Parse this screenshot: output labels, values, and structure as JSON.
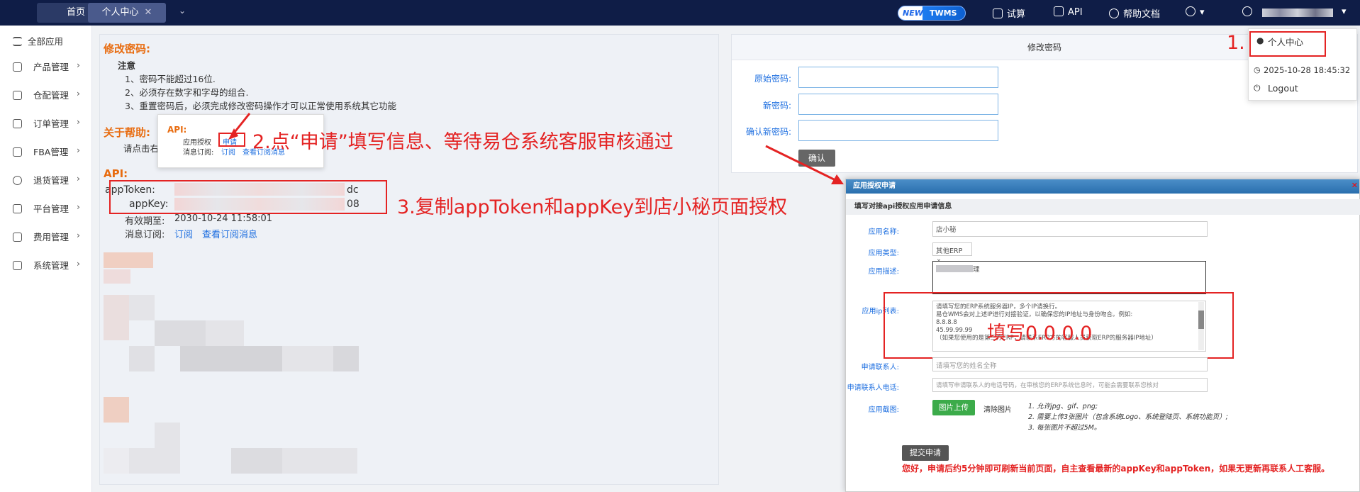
{
  "topbar": {
    "tabs": [
      "首页",
      "个人中心"
    ],
    "tab_close": "✕",
    "tab_more": "⌄",
    "new_badge_new": "NEW",
    "new_badge_brand": "TWMS",
    "nav": [
      "试算",
      "API",
      "帮助文档"
    ]
  },
  "sidebar": {
    "all_apps": "全部应用",
    "items": [
      "产品管理",
      "仓配管理",
      "订单管理",
      "FBA管理",
      "退货管理",
      "平台管理",
      "费用管理",
      "系统管理"
    ]
  },
  "main": {
    "change_pw_title": "修改密码:",
    "notice_title": "注意",
    "notices": [
      "1、密码不能超过16位.",
      "2、必须存在数字和字母的组合.",
      "3、重置密码后，必须完成修改密码操作才可以正常使用系统其它功能"
    ],
    "help_title": "关于帮助:",
    "help_text": "请点击右",
    "api_title": "API:",
    "app_token_label": "appToken:",
    "app_token_tail": "dc",
    "app_key_label": "appKey:",
    "app_key_tail": "08",
    "expire_label": "有效期至:",
    "expire_value": "2030-10-24 11:58:01",
    "subscribe_label": "消息订阅:",
    "subscribe_link": "订阅",
    "view_subscribe_link": "查看订阅消息"
  },
  "api_popup": {
    "title": "API:",
    "auth_label": "应用授权",
    "apply_link": "申请",
    "sub_label": "消息订阅:",
    "sub_link": "订阅",
    "view_link": "查看订阅消息"
  },
  "annotations": {
    "a1": "1.",
    "a2": "2.点“申请”填写信息、等待易仓系统客服审核通过",
    "a3": "3.复制appToken和appKey到店小秘页面授权",
    "a4": "填写0.0.0.0"
  },
  "pw_panel": {
    "title": "修改密码",
    "old_label": "原始密码:",
    "new_label": "新密码:",
    "confirm_label": "确认新密码:",
    "confirm_button": "确认"
  },
  "user_menu": {
    "personal_center": "个人中心",
    "timestamp": "2025-10-28 18:45:32",
    "logout": "Logout"
  },
  "dialog": {
    "title": "应用授权申请",
    "close": "✕",
    "subtitle": "填写对接api授权应用申请信息",
    "app_name_label": "应用名称:",
    "app_name_value": "店小秘",
    "app_type_label": "应用类型:",
    "app_type_value": "其他ERP",
    "app_desc_label": "应用描述:",
    "app_desc_value": "理",
    "ip_label": "应用ip列表:",
    "ip_lines": [
      "请填写您的ERP系统服务器IP，多个IP请换行。",
      "易仓WMS会对上述IP进行对接验证，以确保您的IP地址与身份吻合。例如:",
      "8.8.8.8",
      "45.99.99.99",
      "（如果您使用的是第三方ERP，请联系ERP方的客服人员获取ERP的服务器IP地址）"
    ],
    "contact_label": "申请联系人:",
    "contact_placeholder": "请填写您的姓名全称",
    "phone_label": "申请联系人电话:",
    "phone_placeholder": "请填写申请联系人的电话号码，在审核您的ERP系统信息时，可能会需要联系您核对",
    "screenshot_label": "应用截图:",
    "upload_button": "图片上传",
    "clear_button": "清除图片",
    "rules": [
      "1. 允许jpg、gif、png;",
      "2. 需要上传3张图片（包含系统Logo、系统登陆页、系统功能页）;",
      "3. 每张图片不超过5M。"
    ],
    "submit_button": "提交申请",
    "footer_note": "您好，申请后约5分钟即可刷新当前页面，自主查看最新的appKey和appToken，如果无更新再联系人工客服。"
  }
}
